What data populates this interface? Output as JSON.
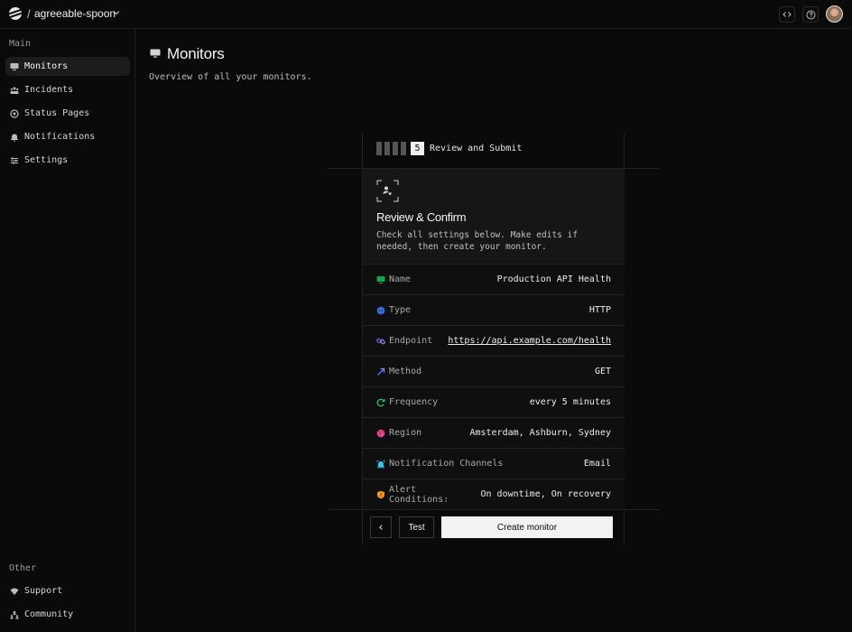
{
  "topbar": {
    "separator": "/",
    "project_name": "agreeable-spoon"
  },
  "sidebar": {
    "main_label": "Main",
    "main_items": [
      {
        "label": "Monitors",
        "icon": "monitor-icon",
        "active": true
      },
      {
        "label": "Incidents",
        "icon": "incidents-icon",
        "active": false
      },
      {
        "label": "Status Pages",
        "icon": "status-page-icon",
        "active": false
      },
      {
        "label": "Notifications",
        "icon": "bell-icon",
        "active": false
      },
      {
        "label": "Settings",
        "icon": "sliders-icon",
        "active": false
      }
    ],
    "other_label": "Other",
    "other_items": [
      {
        "label": "Support",
        "icon": "wifi-icon"
      },
      {
        "label": "Community",
        "icon": "people-icon"
      }
    ]
  },
  "main": {
    "title": "Monitors",
    "subtitle": "Overview of all your monitors."
  },
  "wizard": {
    "current_step": "5",
    "total_steps": 5,
    "step_label": "Review and Submit",
    "heading": "Review & Confirm",
    "description": "Check all settings below. Make edits if needed, then create your monitor.",
    "rows": [
      {
        "label": "Name",
        "value": "Production API Health",
        "icon": "monitor-icon",
        "color": "#16a34a"
      },
      {
        "label": "Type",
        "value": "HTTP",
        "icon": "globe-icon",
        "color": "#3b82f6"
      },
      {
        "label": "Endpoint",
        "value": "https://api.example.com/health",
        "icon": "link-icon",
        "color": "#8b5cf6"
      },
      {
        "label": "Method",
        "value": "GET",
        "icon": "arrow-icon",
        "color": "#6366f1"
      },
      {
        "label": "Frequency",
        "value": "every 5 minutes",
        "icon": "refresh-icon",
        "color": "#22c55e"
      },
      {
        "label": "Region",
        "value": "Amsterdam, Ashburn, Sydney",
        "icon": "earth-icon",
        "color": "#ec4899"
      },
      {
        "label": "Notification Channels",
        "value": "Email",
        "icon": "alarm-icon",
        "color": "#38bdf8"
      },
      {
        "label": "Alert Conditions:",
        "value": "On downtime, On recovery",
        "icon": "shield-icon",
        "color": "#f59e0b"
      }
    ],
    "back_label": "‹",
    "test_label": "Test",
    "create_label": "Create monitor"
  }
}
